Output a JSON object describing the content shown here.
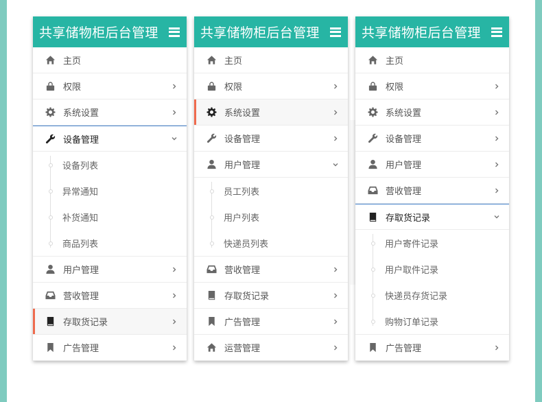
{
  "panels": [
    {
      "title": "共享储物柜后台管理",
      "items": [
        {
          "icon": "home-icon",
          "label": "主页",
          "chevron": "none",
          "state": "normal"
        },
        {
          "icon": "lock-icon",
          "label": "权限",
          "chevron": "right",
          "state": "normal"
        },
        {
          "icon": "gear-icon",
          "label": "系统设置",
          "chevron": "right",
          "state": "normal"
        },
        {
          "icon": "wrench-icon",
          "label": "设备管理",
          "chevron": "down",
          "state": "open",
          "children": [
            "设备列表",
            "异常通知",
            "补货通知",
            "商品列表"
          ]
        },
        {
          "icon": "user-icon",
          "label": "用户管理",
          "chevron": "right",
          "state": "normal"
        },
        {
          "icon": "inbox-icon",
          "label": "营收管理",
          "chevron": "right",
          "state": "normal"
        },
        {
          "icon": "book-icon",
          "label": "存取货记录",
          "chevron": "right",
          "state": "active"
        },
        {
          "icon": "bookmark-icon",
          "label": "广告管理",
          "chevron": "right",
          "state": "normal"
        }
      ]
    },
    {
      "title": "共享储物柜后台管理",
      "items": [
        {
          "icon": "home-icon",
          "label": "主页",
          "chevron": "none",
          "state": "normal"
        },
        {
          "icon": "lock-icon",
          "label": "权限",
          "chevron": "right",
          "state": "normal"
        },
        {
          "icon": "gear-icon",
          "label": "系统设置",
          "chevron": "right",
          "state": "active"
        },
        {
          "icon": "wrench-icon",
          "label": "设备管理",
          "chevron": "right",
          "state": "normal"
        },
        {
          "icon": "user-icon",
          "label": "用户管理",
          "chevron": "down",
          "state": "expanded",
          "children": [
            "员工列表",
            "用户列表",
            "快递员列表"
          ]
        },
        {
          "icon": "inbox-icon",
          "label": "营收管理",
          "chevron": "right",
          "state": "normal"
        },
        {
          "icon": "book-icon",
          "label": "存取货记录",
          "chevron": "right",
          "state": "normal"
        },
        {
          "icon": "bookmark-icon",
          "label": "广告管理",
          "chevron": "right",
          "state": "normal"
        },
        {
          "icon": "home-icon",
          "label": "运营管理",
          "chevron": "right",
          "state": "normal"
        }
      ]
    },
    {
      "title": "共享储物柜后台管理",
      "items": [
        {
          "icon": "home-icon",
          "label": "主页",
          "chevron": "none",
          "state": "normal"
        },
        {
          "icon": "lock-icon",
          "label": "权限",
          "chevron": "right",
          "state": "normal"
        },
        {
          "icon": "gear-icon",
          "label": "系统设置",
          "chevron": "right",
          "state": "normal"
        },
        {
          "icon": "wrench-icon",
          "label": "设备管理",
          "chevron": "right",
          "state": "normal"
        },
        {
          "icon": "user-icon",
          "label": "用户管理",
          "chevron": "right",
          "state": "normal"
        },
        {
          "icon": "inbox-icon",
          "label": "营收管理",
          "chevron": "right",
          "state": "normal"
        },
        {
          "icon": "book-icon",
          "label": "存取货记录",
          "chevron": "down",
          "state": "open",
          "children": [
            "用户寄件记录",
            "用户取件记录",
            "快递员存货记录",
            "购物订单记录"
          ]
        },
        {
          "icon": "bookmark-icon",
          "label": "广告管理",
          "chevron": "right",
          "state": "normal"
        }
      ]
    }
  ],
  "colors": {
    "header": "#27b5a4",
    "active_marker": "#ef6b4e",
    "open_divider": "#3f7ec9",
    "outer_bg": "#7fcbbf"
  }
}
